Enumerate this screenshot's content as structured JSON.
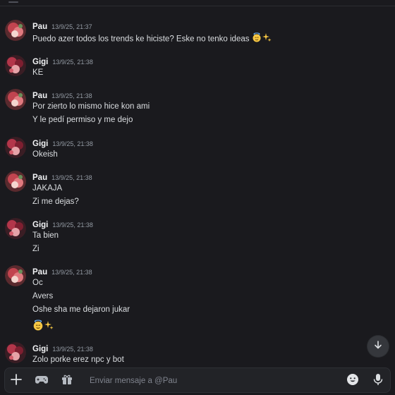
{
  "messages": [
    {
      "author": "Pau",
      "timestamp": "13/9/25, 21:37",
      "lines": [
        "Puedo azer todos los trends ke hiciste? Eske no tenko ideas"
      ],
      "emoji_after_first": true
    },
    {
      "author": "Gigi",
      "timestamp": "13/9/25, 21:38",
      "lines": [
        "KE"
      ]
    },
    {
      "author": "Pau",
      "timestamp": "13/9/25, 21:38",
      "lines": [
        "Por zierto lo mismo hice kon ami",
        "Y le pedí permiso y me dejo"
      ]
    },
    {
      "author": "Gigi",
      "timestamp": "13/9/25, 21:38",
      "lines": [
        "Okeish"
      ]
    },
    {
      "author": "Pau",
      "timestamp": "13/9/25, 21:38",
      "lines": [
        "JAKAJA",
        "Zi me dejas?"
      ]
    },
    {
      "author": "Gigi",
      "timestamp": "13/9/25, 21:38",
      "lines": [
        "Ta bien",
        "Zi"
      ]
    },
    {
      "author": "Pau",
      "timestamp": "13/9/25, 21:38",
      "lines": [
        "Oc",
        "Avers",
        "Oshe sha me dejaron jukar"
      ]
    },
    {
      "author": "Gigi",
      "timestamp": "13/9/25, 21:38",
      "lines": [
        "Zolo porke erez npc y bot"
      ]
    }
  ],
  "composer": {
    "placeholder": "Enviar mensaje a @Pau"
  },
  "icons": {
    "add": "plus-icon",
    "gif": "gamepad-icon",
    "gift": "gift-icon",
    "emoji": "emoji-icon",
    "mic": "microphone-icon",
    "scroll": "arrow-down-icon",
    "emoji_glyphs": "angel-sparkles-emoji"
  },
  "colors": {
    "background": "#1a1a1e",
    "text": "#dbdee1",
    "author": "#f2f3f5",
    "muted": "#949ba4"
  }
}
